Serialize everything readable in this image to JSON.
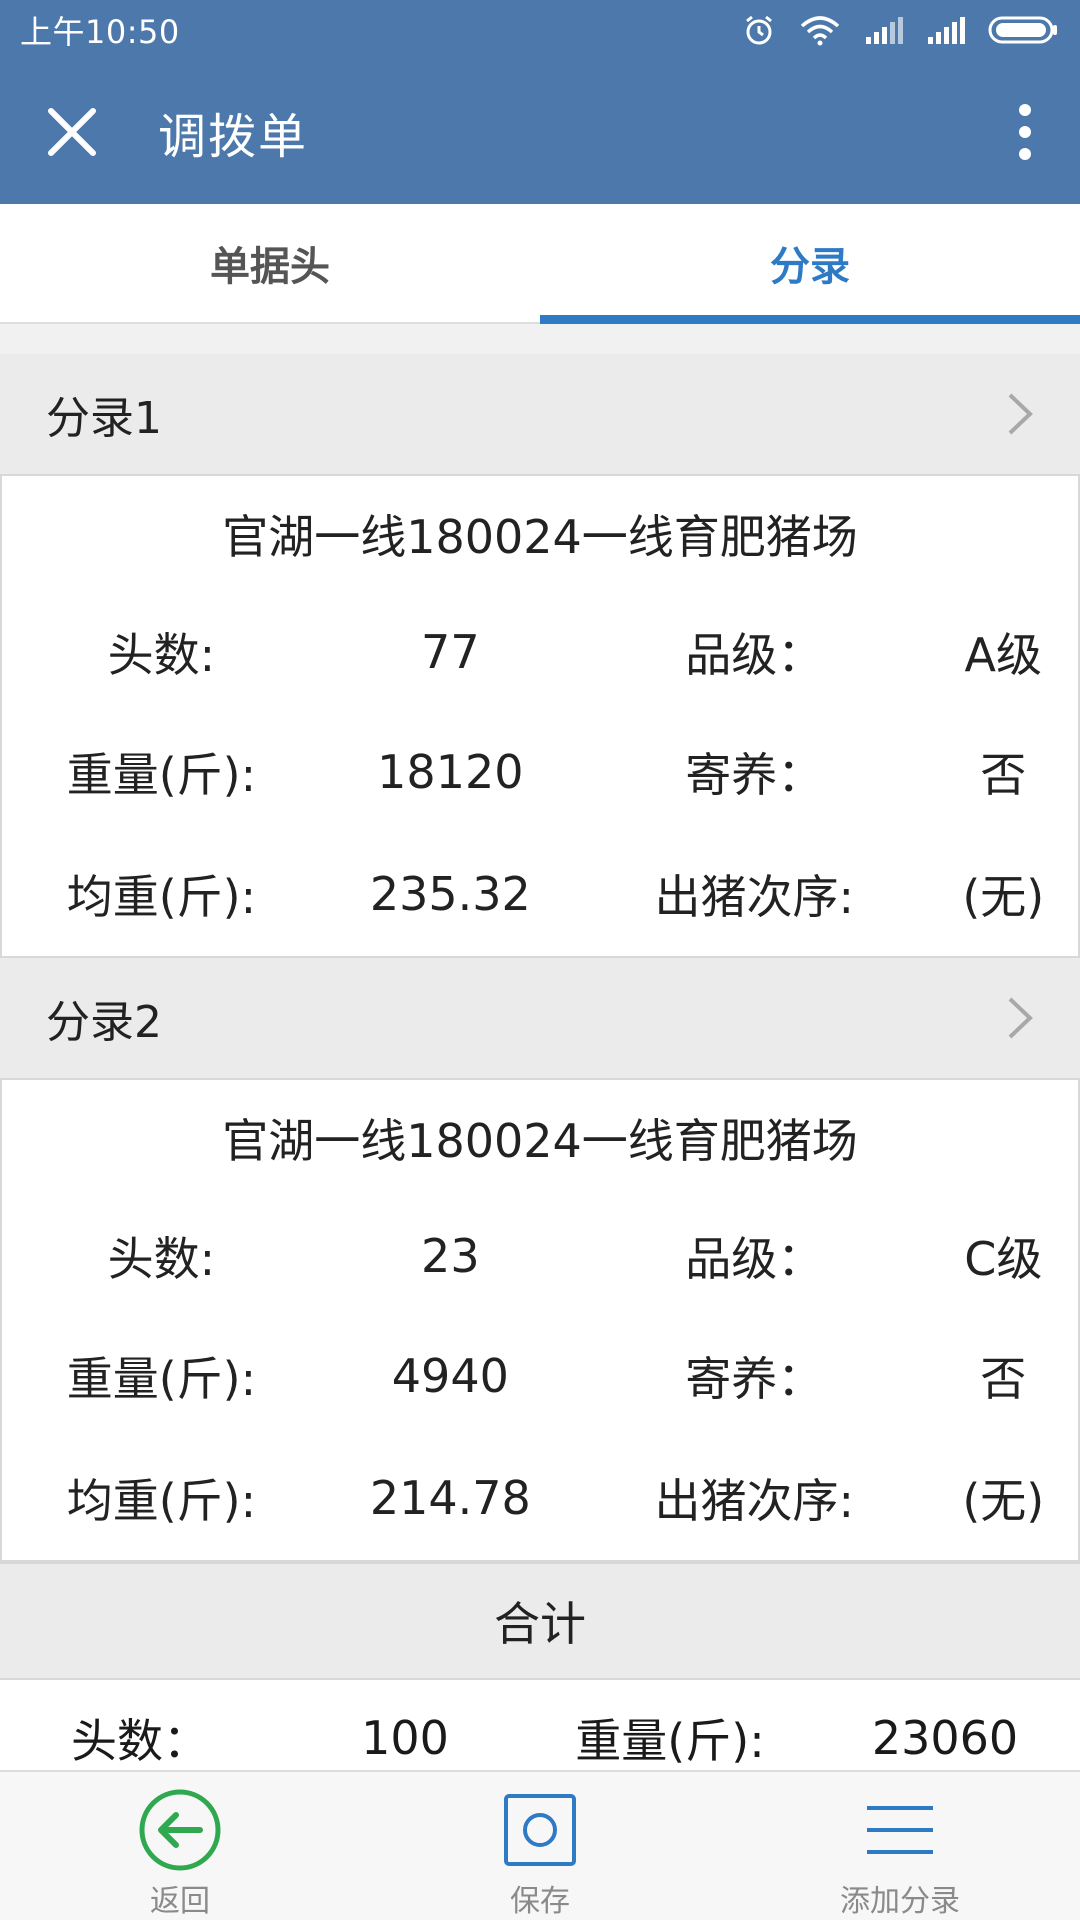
{
  "status_bar": {
    "time": "上午10:50"
  },
  "app_bar": {
    "title": "调拨单"
  },
  "tabs": [
    {
      "label": "单据头",
      "active": false
    },
    {
      "label": "分录",
      "active": true
    }
  ],
  "entries": [
    {
      "header": "分录1",
      "farm": "官湖一线180024一线育肥猪场",
      "rows": [
        {
          "label1": "头数:",
          "value1": "77",
          "label2": "品级：",
          "value2": "A级"
        },
        {
          "label1": "重量(斤):",
          "value1": "18120",
          "label2": "寄养：",
          "value2": "否"
        },
        {
          "label1": "均重(斤):",
          "value1": "235.32",
          "label2": "出猪次序:",
          "value2": "(无)"
        }
      ]
    },
    {
      "header": "分录2",
      "farm": "官湖一线180024一线育肥猪场",
      "rows": [
        {
          "label1": "头数:",
          "value1": "23",
          "label2": "品级：",
          "value2": "C级"
        },
        {
          "label1": "重量(斤):",
          "value1": "4940",
          "label2": "寄养：",
          "value2": "否"
        },
        {
          "label1": "均重(斤):",
          "value1": "214.78",
          "label2": "出猪次序:",
          "value2": "(无)"
        }
      ]
    }
  ],
  "total": {
    "header": "合计",
    "label1": "头数：",
    "value1": "100",
    "label2": "重量(斤):",
    "value2": "23060"
  },
  "bottom_bar": {
    "back_label": "返回",
    "save_label": "保存",
    "add_label": "添加分录"
  },
  "colors": {
    "primary": "#4d78ab",
    "tab_active": "#2f7ac4",
    "back_green": "#2fa84f",
    "save_blue": "#2f7ac4"
  }
}
